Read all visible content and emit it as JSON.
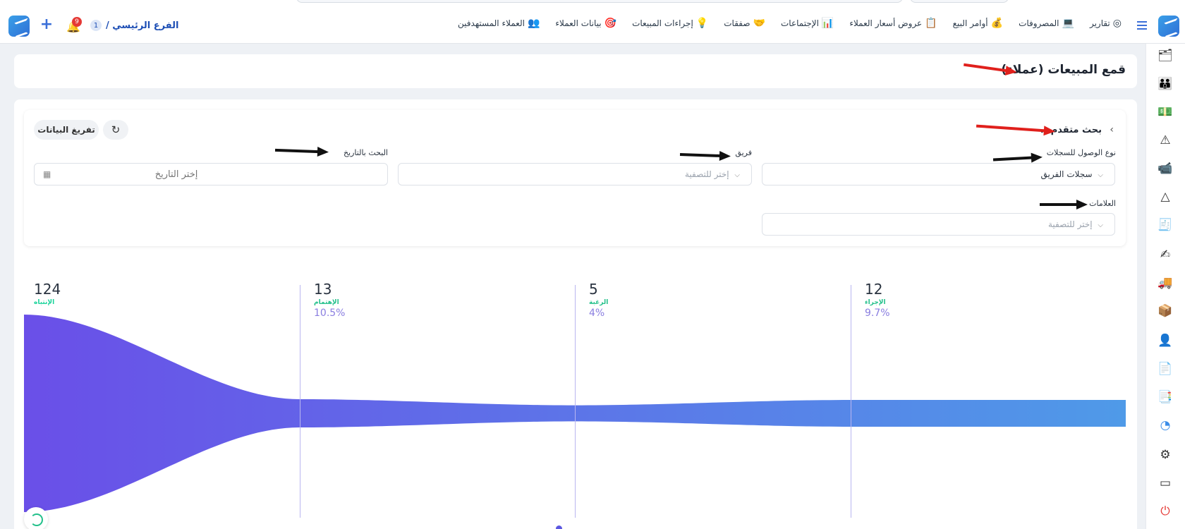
{
  "topbar": {
    "nav": [
      {
        "label": "العملاء المستهدفين",
        "icon": "👥"
      },
      {
        "label": "بيانات العملاء",
        "icon": "🎯"
      },
      {
        "label": "إجراءات المبيعات",
        "icon": "💡"
      },
      {
        "label": "صفقات",
        "icon": "🤝"
      },
      {
        "label": "الإجتماعات",
        "icon": "📊"
      },
      {
        "label": "عروض أسعار العملاء",
        "icon": "📋"
      },
      {
        "label": "أوامر البيع",
        "icon": "💰"
      },
      {
        "label": "المصروفات",
        "icon": "💻"
      },
      {
        "label": "تقارير",
        "icon": "◎"
      }
    ],
    "branch_name": "الفرع الرئيسي /",
    "branch_count": "1",
    "notifications_count": "9"
  },
  "page": {
    "title": "قمع المبيعات (عملاء)"
  },
  "filters": {
    "advanced_search": "بحث متقدم...",
    "clear_button": "تفريغ البيانات",
    "access_type_label": "نوع الوصول للسجلات",
    "access_type_value": "سجلات الفريق",
    "team_label": "فريق",
    "team_placeholder": "إختر للتصفية",
    "date_label": "البحث بالتاريخ",
    "date_placeholder": "إختر التاريخ",
    "tags_label": "العلامات",
    "tags_placeholder": "إختر للتصفية"
  },
  "chart_data": {
    "type": "funnel",
    "stages": [
      {
        "name": "الإنتباه",
        "value": 124,
        "percent": ""
      },
      {
        "name": "الإهتمام",
        "value": 13,
        "percent": "10.5%"
      },
      {
        "name": "الرغبة",
        "value": 5,
        "percent": "4%"
      },
      {
        "name": "الإجراء",
        "value": 12,
        "percent": "9.7%"
      }
    ],
    "colors": {
      "start": "#6a4fe8",
      "end": "#4f9ae8",
      "first_label": "#19d39a",
      "other_labels": "#22c08a",
      "percent": "#8a7ee0"
    }
  }
}
